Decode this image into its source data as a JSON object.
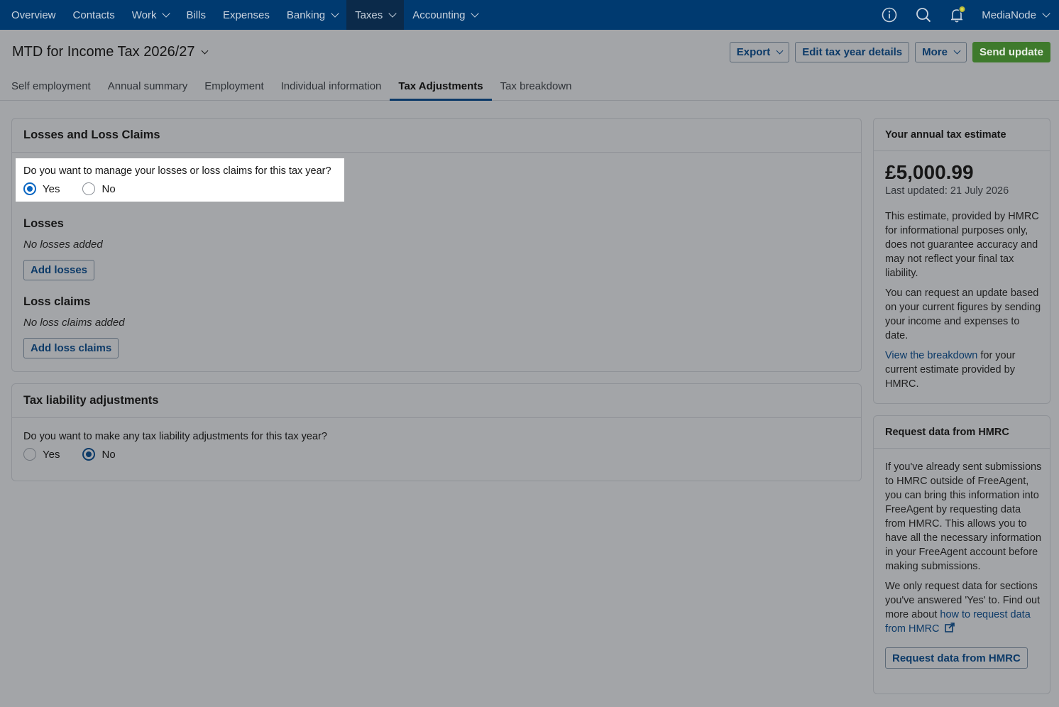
{
  "nav": {
    "items": [
      {
        "label": "Overview",
        "dropdown": false
      },
      {
        "label": "Contacts",
        "dropdown": false
      },
      {
        "label": "Work",
        "dropdown": true
      },
      {
        "label": "Bills",
        "dropdown": false
      },
      {
        "label": "Expenses",
        "dropdown": false
      },
      {
        "label": "Banking",
        "dropdown": true
      },
      {
        "label": "Taxes",
        "dropdown": true,
        "active": true
      },
      {
        "label": "Accounting",
        "dropdown": true
      }
    ],
    "account_name": "MediaNode",
    "icons": [
      "info-icon",
      "search-icon",
      "bell-icon",
      "chevron-down-icon"
    ]
  },
  "header": {
    "title": "MTD for Income Tax 2026/27",
    "export_label": "Export",
    "edit_label": "Edit tax year details",
    "more_label": "More",
    "send_label": "Send update"
  },
  "tabs": [
    {
      "label": "Self employment"
    },
    {
      "label": "Annual summary"
    },
    {
      "label": "Employment"
    },
    {
      "label": "Individual information"
    },
    {
      "label": "Tax Adjustments",
      "active": true
    },
    {
      "label": "Tax breakdown"
    }
  ],
  "losses_card": {
    "title": "Losses and Loss Claims",
    "question": "Do you want to manage your losses or loss claims for this tax year?",
    "yes_label": "Yes",
    "no_label": "No",
    "selected": "Yes",
    "losses_heading": "Losses",
    "losses_empty": "No losses added",
    "add_losses_label": "Add losses",
    "claims_heading": "Loss claims",
    "claims_empty": "No loss claims added",
    "add_claims_label": "Add loss claims"
  },
  "liability_card": {
    "title": "Tax liability adjustments",
    "question": "Do you want to make any tax liability adjustments for this tax year?",
    "yes_label": "Yes",
    "no_label": "No",
    "selected": "No"
  },
  "estimate_card": {
    "title": "Your annual tax estimate",
    "amount": "£5,000.99",
    "last_updated": "Last updated: 21 July 2026",
    "para1": "This estimate, provided by HMRC for informational purposes only, does not guarantee accuracy and may not reflect your final tax liability.",
    "para2": "You can request an update based on your current figures by sending your income and expenses to date.",
    "para3_link": "View the breakdown",
    "para3_rest": " for your current estimate provided by HMRC."
  },
  "request_card": {
    "title": "Request data from HMRC",
    "para1": "If you've already sent submissions to HMRC outside of FreeAgent, you can bring this information into FreeAgent by requesting data from HMRC. This allows you to have all the necessary information in your FreeAgent account before making submissions.",
    "para2_text": "We only request data for sections you've answered 'Yes' to. Find out more about ",
    "para2_link": "how to request data from HMRC",
    "button_label": "Request data from HMRC"
  },
  "colors": {
    "nav_bg": "#003a70",
    "link": "#0c3a68",
    "primary_green": "#3e7a2c",
    "overlay_gray": "#a3a5a8"
  }
}
